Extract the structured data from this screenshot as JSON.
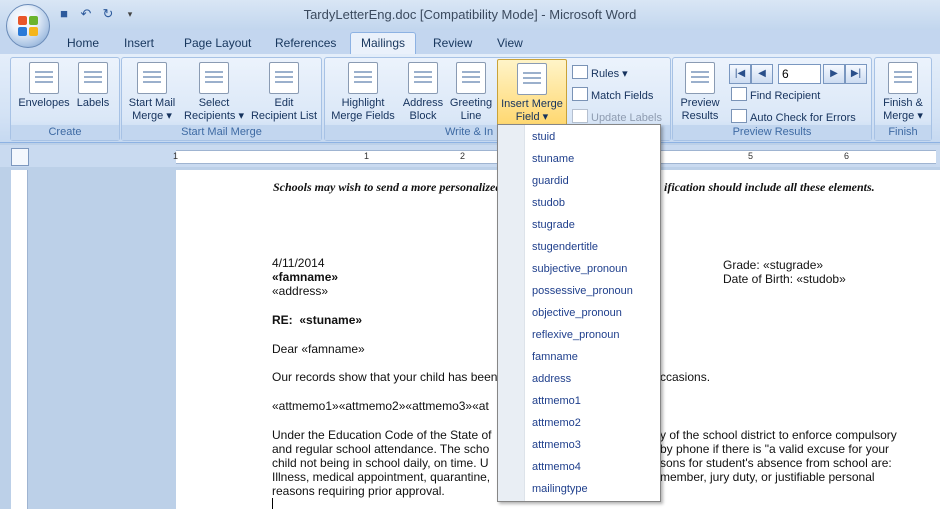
{
  "window": {
    "title": "TardyLetterEng.doc [Compatibility Mode] - Microsoft Word"
  },
  "tabs": [
    "Home",
    "Insert",
    "Page Layout",
    "References",
    "Mailings",
    "Review",
    "View"
  ],
  "active_tab": "Mailings",
  "ribbon": {
    "groups": {
      "create": "Create",
      "start_mail_merge": "Start Mail Merge",
      "write_insert": "Write & In",
      "preview_results": "Preview Results",
      "finish": "Finish"
    },
    "create": {
      "envelopes": "Envelopes",
      "labels": "Labels"
    },
    "start": {
      "start_mail_merge_1": "Start Mail",
      "start_mail_merge_2": "Merge",
      "select_recipients_1": "Select",
      "select_recipients_2": "Recipients",
      "edit_list_1": "Edit",
      "edit_list_2": "Recipient List"
    },
    "write": {
      "highlight_1": "Highlight",
      "highlight_2": "Merge Fields",
      "address_1": "Address",
      "address_2": "Block",
      "greeting_1": "Greeting",
      "greeting_2": "Line",
      "insert_merge_1": "Insert Merge",
      "insert_merge_2": "Field",
      "rules": "Rules",
      "match_fields": "Match Fields",
      "update_labels": "Update Labels"
    },
    "preview": {
      "preview_1": "Preview",
      "preview_2": "Results",
      "record": "6",
      "find_recipient": "Find Recipient",
      "auto_check": "Auto Check for Errors"
    },
    "finish": {
      "finish_1": "Finish &",
      "finish_2": "Merge"
    }
  },
  "ruler": {
    "nums": [
      "1",
      "1",
      "2",
      "3",
      "4",
      "5",
      "6"
    ]
  },
  "document": {
    "intro": "Schools may wish to send a more personalized",
    "intro_right": "ification should include all these elements.",
    "date": "4/11/2014",
    "famname": "«famname»",
    "address": "«address»",
    "grade": "Grade: «stugrade»",
    "dob": "Date of Birth: «studob»",
    "re_label": "RE:",
    "re_value": "«stuname»",
    "dear": "Dear «famname»",
    "records": "Our records show that your child has been",
    "records_right": "ccasions.",
    "attmemo": "«attmemo1»«attmemo2»«attmemo3»«at",
    "p1_l1a": "Under the Education Code of the State of",
    "p1_l1b": "y of the school district to enforce compulsory",
    "p1_l2a": "and regular school attendance.  The scho",
    "p1_l2b": "by phone if there is \"a valid excuse for your",
    "p1_l3a": "child not being in school daily, on time.  U",
    "p1_l3b": "sons for student's absence from school are:",
    "p1_l4a": "Illness, medical appointment, quarantine,",
    "p1_l4b": "member, jury duty, or justifiable personal",
    "p1_l5": "reasons requiring prior approval."
  },
  "merge_fields": [
    "stuid",
    "stuname",
    "guardid",
    "studob",
    "stugrade",
    "stugendertitle",
    "subjective_pronoun",
    "possessive_pronoun",
    "objective_pronoun",
    "reflexive_pronoun",
    "famname",
    "address",
    "attmemo1",
    "attmemo2",
    "attmemo3",
    "attmemo4",
    "mailingtype"
  ]
}
